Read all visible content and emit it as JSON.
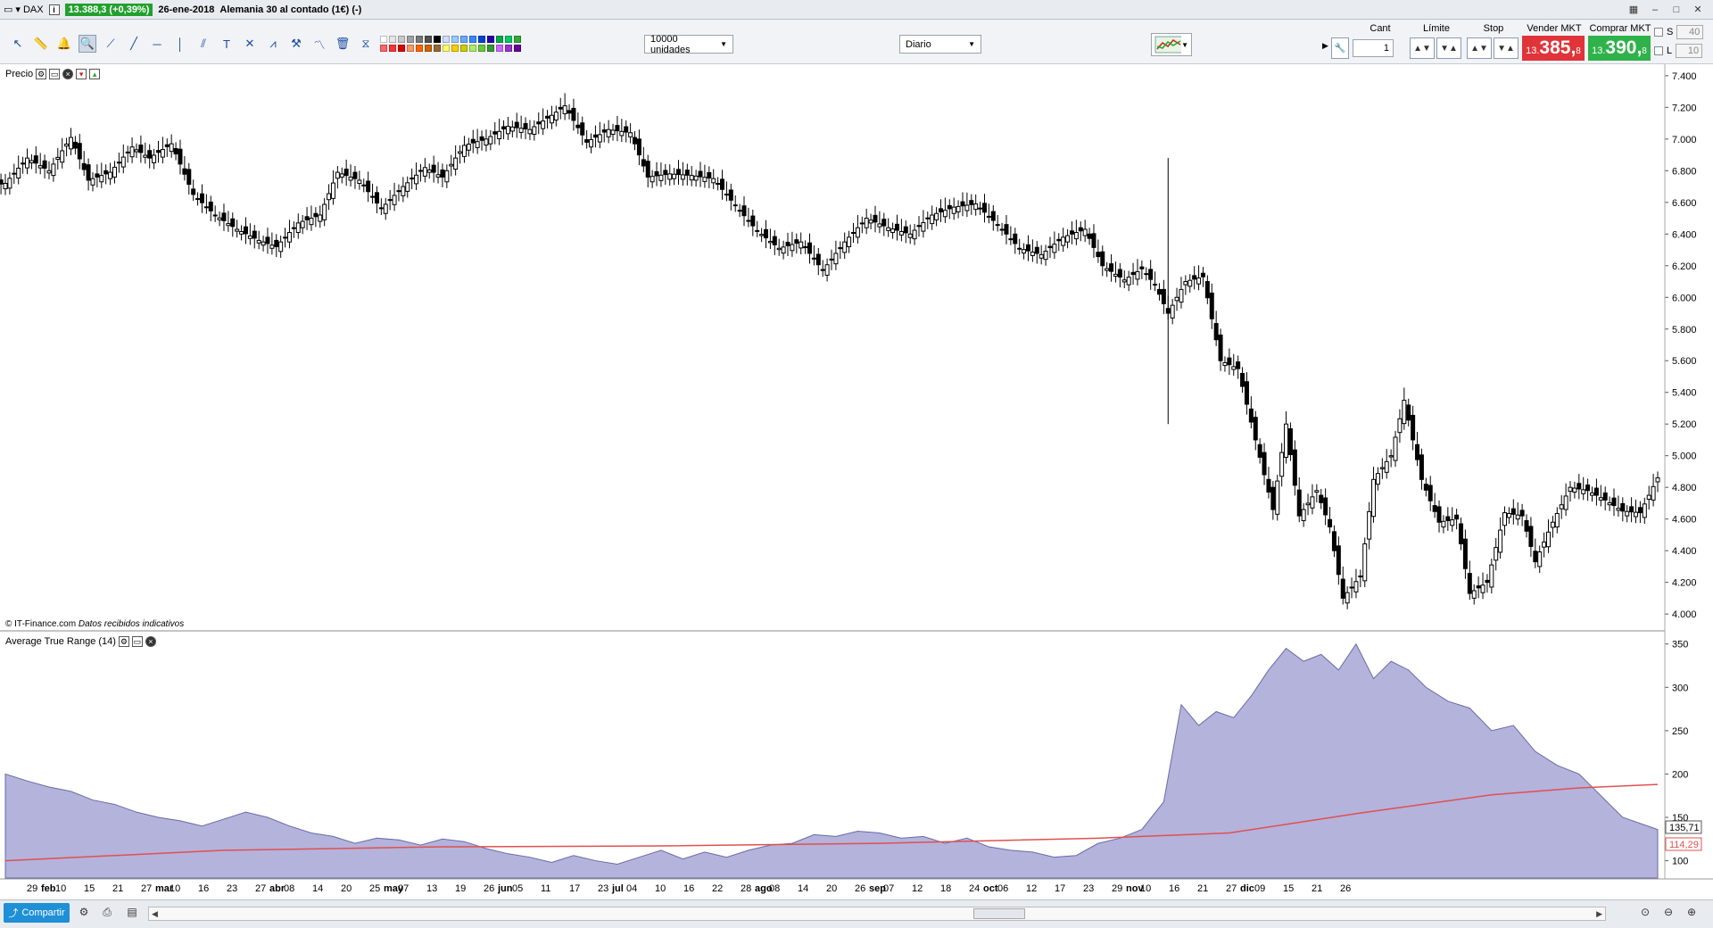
{
  "titlebar": {
    "menu_label": "DAX",
    "price_badge": "13.388,3 (+0,39%)",
    "date": "26-ene-2018",
    "instrument": "Alemania 30 al contado (1€) (-)",
    "price_badge_color": "#22a02e"
  },
  "toolbar": {
    "tools": [
      "pointer-icon",
      "ruler-icon",
      "alarm-bell-icon",
      "zoom-magnifier-icon",
      "trendline-icon",
      "extended-line-icon",
      "horizontal-line-icon",
      "vertical-line-icon",
      "channel-icon",
      "text-icon",
      "fibonacci-icon",
      "gann-fan-icon",
      "pitchfork-icon",
      "trend-tool-icon",
      "delete-icon",
      "pattern-icon"
    ],
    "swatch_colors": [
      "#ffffff",
      "#e6e6e6",
      "#c8c8c8",
      "#a0a0a0",
      "#787878",
      "#505050",
      "#000000",
      "#ccddff",
      "#99ccff",
      "#66aaff",
      "#3388ff",
      "#0044cc",
      "#2200aa",
      "#00aa44",
      "#00cc66",
      "#33aa33",
      "#ff6666",
      "#ff3333",
      "#dd0000",
      "#ff9966",
      "#ff6600",
      "#cc6600",
      "#996633",
      "#ffff66",
      "#ffcc00",
      "#cccc00",
      "#aaee66",
      "#66cc33",
      "#339933",
      "#cc66ff",
      "#9933cc",
      "#660099"
    ],
    "quantity_select": "10000 unidades",
    "period_select": "Diario",
    "chart_type_icon": "candlestick-chart-icon"
  },
  "order_panel": {
    "qty_label": "Cant",
    "qty_value": "1",
    "limit_label": "Límite",
    "stop_label": "Stop",
    "sell_label": "Vender MKT",
    "buy_label": "Comprar MKT",
    "sell_prefix": "13.",
    "sell_main": "385,",
    "sell_sup": "8",
    "buy_prefix": "13.",
    "buy_main": "390,",
    "buy_sup": "8",
    "s_label": "S",
    "s_value": "40",
    "l_label": "L",
    "l_value": "10",
    "sell_color": "#e0343a",
    "buy_color": "#2fb24a"
  },
  "price_panel": {
    "label": "Precio",
    "copyright": "© IT-Finance.com",
    "copyright_note": "Datos recibidos indicativos"
  },
  "atr_panel": {
    "label": "Average True Range (14)",
    "current_value": "135,71",
    "ma_value": "114,29"
  },
  "bottombar": {
    "share_label": "Compartir"
  },
  "chart_data": [
    {
      "type": "candlestick",
      "series_name": "Precio",
      "y_ticks": [
        "7.400",
        "7.200",
        "7.000",
        "6.800",
        "6.600",
        "6.400",
        "6.200",
        "6.000",
        "5.800",
        "5.600",
        "5.400",
        "5.200",
        "5.000",
        "4.800",
        "4.600",
        "4.400",
        "4.200",
        "4.000"
      ],
      "ylim": [
        3950,
        7450
      ],
      "x_tick_labels": [
        "29",
        "feb",
        "10",
        "15",
        "21",
        "27",
        "mar",
        "10",
        "16",
        "23",
        "27",
        "abr",
        "08",
        "14",
        "20",
        "25",
        "may",
        "07",
        "13",
        "19",
        "26",
        "jun",
        "05",
        "11",
        "17",
        "23",
        "jul",
        "04",
        "10",
        "16",
        "22",
        "28",
        "ago",
        "08",
        "14",
        "20",
        "26",
        "sep",
        "07",
        "12",
        "18",
        "24",
        "oct",
        "06",
        "12",
        "17",
        "23",
        "29",
        "nov",
        "10",
        "16",
        "21",
        "27",
        "dic",
        "09",
        "15",
        "21",
        "26"
      ],
      "close_path": [
        {
          "x": 0,
          "y": 6720
        },
        {
          "x": 10,
          "y": 6880
        },
        {
          "x": 20,
          "y": 6800
        },
        {
          "x": 30,
          "y": 7010
        },
        {
          "x": 38,
          "y": 6740
        },
        {
          "x": 48,
          "y": 6790
        },
        {
          "x": 58,
          "y": 6950
        },
        {
          "x": 66,
          "y": 6880
        },
        {
          "x": 76,
          "y": 6970
        },
        {
          "x": 86,
          "y": 6650
        },
        {
          "x": 96,
          "y": 6520
        },
        {
          "x": 106,
          "y": 6430
        },
        {
          "x": 116,
          "y": 6360
        },
        {
          "x": 124,
          "y": 6320
        },
        {
          "x": 134,
          "y": 6470
        },
        {
          "x": 144,
          "y": 6520
        },
        {
          "x": 152,
          "y": 6790
        },
        {
          "x": 162,
          "y": 6740
        },
        {
          "x": 172,
          "y": 6560
        },
        {
          "x": 182,
          "y": 6700
        },
        {
          "x": 192,
          "y": 6820
        },
        {
          "x": 200,
          "y": 6760
        },
        {
          "x": 210,
          "y": 6960
        },
        {
          "x": 220,
          "y": 7000
        },
        {
          "x": 230,
          "y": 7080
        },
        {
          "x": 240,
          "y": 7060
        },
        {
          "x": 250,
          "y": 7150
        },
        {
          "x": 256,
          "y": 7210
        },
        {
          "x": 266,
          "y": 6980
        },
        {
          "x": 276,
          "y": 7060
        },
        {
          "x": 286,
          "y": 7040
        },
        {
          "x": 294,
          "y": 6760
        },
        {
          "x": 304,
          "y": 6780
        },
        {
          "x": 314,
          "y": 6770
        },
        {
          "x": 324,
          "y": 6750
        },
        {
          "x": 334,
          "y": 6580
        },
        {
          "x": 344,
          "y": 6420
        },
        {
          "x": 354,
          "y": 6310
        },
        {
          "x": 364,
          "y": 6350
        },
        {
          "x": 374,
          "y": 6170
        },
        {
          "x": 384,
          "y": 6350
        },
        {
          "x": 394,
          "y": 6500
        },
        {
          "x": 404,
          "y": 6440
        },
        {
          "x": 414,
          "y": 6400
        },
        {
          "x": 424,
          "y": 6520
        },
        {
          "x": 434,
          "y": 6570
        },
        {
          "x": 444,
          "y": 6590
        },
        {
          "x": 454,
          "y": 6460
        },
        {
          "x": 464,
          "y": 6310
        },
        {
          "x": 474,
          "y": 6270
        },
        {
          "x": 484,
          "y": 6380
        },
        {
          "x": 494,
          "y": 6430
        },
        {
          "x": 502,
          "y": 6200
        },
        {
          "x": 512,
          "y": 6110
        },
        {
          "x": 520,
          "y": 6180
        },
        {
          "x": 526,
          "y": 6080
        },
        {
          "x": 532,
          "y": 5900
        },
        {
          "x": 540,
          "y": 6100
        },
        {
          "x": 548,
          "y": 6130
        },
        {
          "x": 556,
          "y": 5600
        },
        {
          "x": 564,
          "y": 5550
        },
        {
          "x": 572,
          "y": 5100
        },
        {
          "x": 580,
          "y": 4660
        },
        {
          "x": 586,
          "y": 5200
        },
        {
          "x": 592,
          "y": 4620
        },
        {
          "x": 600,
          "y": 4780
        },
        {
          "x": 606,
          "y": 4550
        },
        {
          "x": 612,
          "y": 4100
        },
        {
          "x": 620,
          "y": 4240
        },
        {
          "x": 626,
          "y": 4850
        },
        {
          "x": 634,
          "y": 5000
        },
        {
          "x": 640,
          "y": 5350
        },
        {
          "x": 648,
          "y": 4850
        },
        {
          "x": 656,
          "y": 4580
        },
        {
          "x": 664,
          "y": 4600
        },
        {
          "x": 670,
          "y": 4130
        },
        {
          "x": 678,
          "y": 4200
        },
        {
          "x": 686,
          "y": 4640
        },
        {
          "x": 694,
          "y": 4620
        },
        {
          "x": 700,
          "y": 4330
        },
        {
          "x": 708,
          "y": 4580
        },
        {
          "x": 716,
          "y": 4800
        },
        {
          "x": 724,
          "y": 4780
        },
        {
          "x": 732,
          "y": 4720
        },
        {
          "x": 740,
          "y": 4650
        },
        {
          "x": 748,
          "y": 4640
        },
        {
          "x": 756,
          "y": 4860
        }
      ]
    },
    {
      "type": "area",
      "series": [
        {
          "name": "Average True Range (14)",
          "color": "#b3b3dc"
        },
        {
          "name": "MA",
          "color": "#e05050"
        }
      ],
      "y_ticks": [
        "350",
        "300",
        "250",
        "200",
        "150",
        "100"
      ],
      "ylim": [
        80,
        360
      ],
      "atr_path": [
        {
          "x": 0,
          "y": 200
        },
        {
          "x": 10,
          "y": 192
        },
        {
          "x": 20,
          "y": 185
        },
        {
          "x": 30,
          "y": 180
        },
        {
          "x": 40,
          "y": 170
        },
        {
          "x": 50,
          "y": 165
        },
        {
          "x": 60,
          "y": 156
        },
        {
          "x": 70,
          "y": 150
        },
        {
          "x": 80,
          "y": 146
        },
        {
          "x": 90,
          "y": 140
        },
        {
          "x": 100,
          "y": 148
        },
        {
          "x": 110,
          "y": 156
        },
        {
          "x": 120,
          "y": 150
        },
        {
          "x": 130,
          "y": 140
        },
        {
          "x": 140,
          "y": 132
        },
        {
          "x": 150,
          "y": 128
        },
        {
          "x": 160,
          "y": 120
        },
        {
          "x": 170,
          "y": 126
        },
        {
          "x": 180,
          "y": 124
        },
        {
          "x": 190,
          "y": 118
        },
        {
          "x": 200,
          "y": 125
        },
        {
          "x": 210,
          "y": 122
        },
        {
          "x": 220,
          "y": 114
        },
        {
          "x": 230,
          "y": 108
        },
        {
          "x": 240,
          "y": 104
        },
        {
          "x": 250,
          "y": 98
        },
        {
          "x": 260,
          "y": 106
        },
        {
          "x": 270,
          "y": 100
        },
        {
          "x": 280,
          "y": 96
        },
        {
          "x": 290,
          "y": 104
        },
        {
          "x": 300,
          "y": 112
        },
        {
          "x": 310,
          "y": 102
        },
        {
          "x": 320,
          "y": 110
        },
        {
          "x": 330,
          "y": 104
        },
        {
          "x": 340,
          "y": 112
        },
        {
          "x": 350,
          "y": 118
        },
        {
          "x": 360,
          "y": 120
        },
        {
          "x": 370,
          "y": 130
        },
        {
          "x": 380,
          "y": 128
        },
        {
          "x": 390,
          "y": 134
        },
        {
          "x": 400,
          "y": 132
        },
        {
          "x": 410,
          "y": 126
        },
        {
          "x": 420,
          "y": 128
        },
        {
          "x": 430,
          "y": 120
        },
        {
          "x": 440,
          "y": 126
        },
        {
          "x": 450,
          "y": 116
        },
        {
          "x": 460,
          "y": 112
        },
        {
          "x": 470,
          "y": 110
        },
        {
          "x": 480,
          "y": 104
        },
        {
          "x": 490,
          "y": 106
        },
        {
          "x": 500,
          "y": 120
        },
        {
          "x": 510,
          "y": 126
        },
        {
          "x": 520,
          "y": 136
        },
        {
          "x": 530,
          "y": 168
        },
        {
          "x": 538,
          "y": 280
        },
        {
          "x": 546,
          "y": 256
        },
        {
          "x": 554,
          "y": 272
        },
        {
          "x": 562,
          "y": 265
        },
        {
          "x": 570,
          "y": 290
        },
        {
          "x": 578,
          "y": 320
        },
        {
          "x": 586,
          "y": 345
        },
        {
          "x": 594,
          "y": 330
        },
        {
          "x": 602,
          "y": 338
        },
        {
          "x": 610,
          "y": 320
        },
        {
          "x": 618,
          "y": 350
        },
        {
          "x": 626,
          "y": 310
        },
        {
          "x": 634,
          "y": 330
        },
        {
          "x": 642,
          "y": 320
        },
        {
          "x": 650,
          "y": 300
        },
        {
          "x": 660,
          "y": 284
        },
        {
          "x": 670,
          "y": 276
        },
        {
          "x": 680,
          "y": 250
        },
        {
          "x": 690,
          "y": 256
        },
        {
          "x": 700,
          "y": 226
        },
        {
          "x": 710,
          "y": 210
        },
        {
          "x": 720,
          "y": 200
        },
        {
          "x": 730,
          "y": 175
        },
        {
          "x": 740,
          "y": 150
        },
        {
          "x": 756,
          "y": 136
        }
      ],
      "ma_path": [
        {
          "x": 0,
          "y": 100
        },
        {
          "x": 100,
          "y": 112
        },
        {
          "x": 200,
          "y": 116
        },
        {
          "x": 300,
          "y": 117
        },
        {
          "x": 400,
          "y": 120
        },
        {
          "x": 500,
          "y": 126
        },
        {
          "x": 560,
          "y": 132
        },
        {
          "x": 620,
          "y": 155
        },
        {
          "x": 680,
          "y": 176
        },
        {
          "x": 720,
          "y": 184
        },
        {
          "x": 756,
          "y": 188
        }
      ]
    }
  ]
}
